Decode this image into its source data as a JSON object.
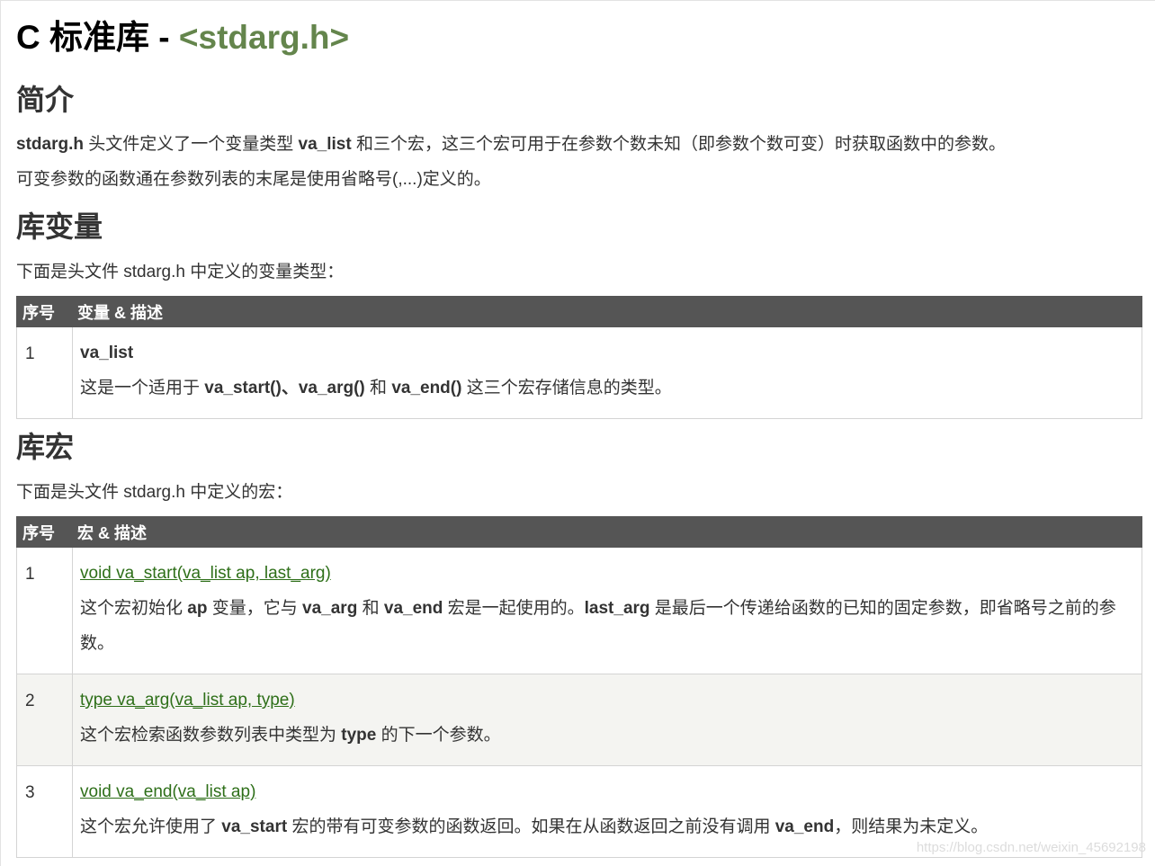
{
  "title": {
    "prefix": "C 标准库 - ",
    "code": "<stdarg.h>"
  },
  "intro": {
    "heading": "简介",
    "p1": {
      "b1": "stdarg.h",
      "t1": " 头文件定义了一个变量类型 ",
      "b2": "va_list",
      "t2": " 和三个宏，这三个宏可用于在参数个数未知（即参数个数可变）时获取函数中的参数。"
    },
    "p2": "可变参数的函数通在参数列表的末尾是使用省略号(,...)定义的。"
  },
  "variables": {
    "heading": "库变量",
    "intro": "下面是头文件 stdarg.h 中定义的变量类型：",
    "col_num": "序号",
    "col_desc": "变量 & 描述",
    "rows": [
      {
        "num": "1",
        "name": "va_list",
        "d1": "这是一个适用于 ",
        "b1": "va_start()、va_arg()",
        "d2": " 和 ",
        "b2": "va_end()",
        "d3": " 这三个宏存储信息的类型。"
      }
    ]
  },
  "macros": {
    "heading": "库宏",
    "intro": "下面是头文件 stdarg.h 中定义的宏：",
    "col_num": "序号",
    "col_desc": "宏 & 描述",
    "rows": [
      {
        "num": "1",
        "link": "void va_start(va_list ap, last_arg)",
        "d1": "这个宏初始化 ",
        "b1": "ap",
        "d2": " 变量，它与 ",
        "b2": "va_arg",
        "d3": " 和 ",
        "b3": "va_end",
        "d4": " 宏是一起使用的。",
        "b4": "last_arg",
        "d5": " 是最后一个传递给函数的已知的固定参数，即省略号之前的参数。"
      },
      {
        "num": "2",
        "link": "type va_arg(va_list ap, type)",
        "d1": "这个宏检索函数参数列表中类型为 ",
        "b1": "type",
        "d2": " 的下一个参数。"
      },
      {
        "num": "3",
        "link": "void va_end(va_list ap)",
        "d1": "这个宏允许使用了 ",
        "b1": "va_start",
        "d2": " 宏的带有可变参数的函数返回。如果在从函数返回之前没有调用 ",
        "b2": "va_end",
        "d3": "，则结果为未定义。"
      }
    ]
  },
  "watermark": "https://blog.csdn.net/weixin_45692198",
  "colors": {
    "title_code": "#64854c",
    "link": "#2e6f19",
    "table_header_bg": "#555555",
    "alt_row_bg": "#f4f4f1"
  }
}
